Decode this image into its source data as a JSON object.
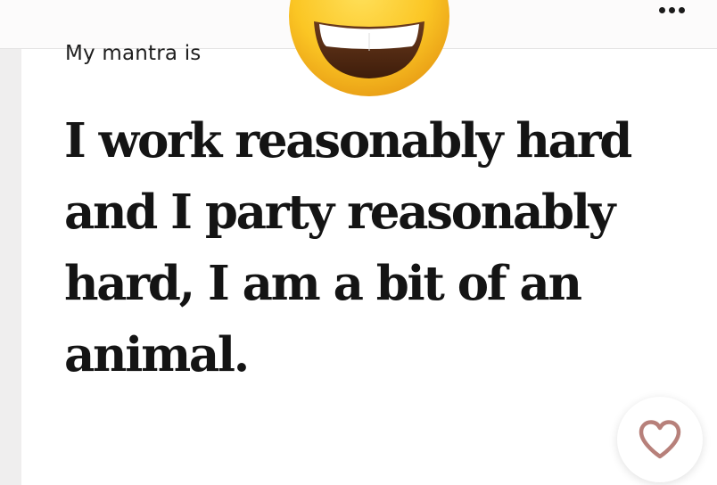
{
  "header": {
    "more_menu_icon": "more-horizontal-icon"
  },
  "prompt": {
    "label": "My mantra is",
    "answer": "I work reasonably hard and I party reasonably hard, I am a bit of an animal."
  },
  "decoration": {
    "emoji_icon": "grinning-face-with-smiling-eyes-emoji"
  },
  "actions": {
    "like_icon": "heart-outline-icon"
  },
  "colors": {
    "accent_heart": "#b7807a",
    "text": "#141414",
    "background": "#efeeee"
  }
}
